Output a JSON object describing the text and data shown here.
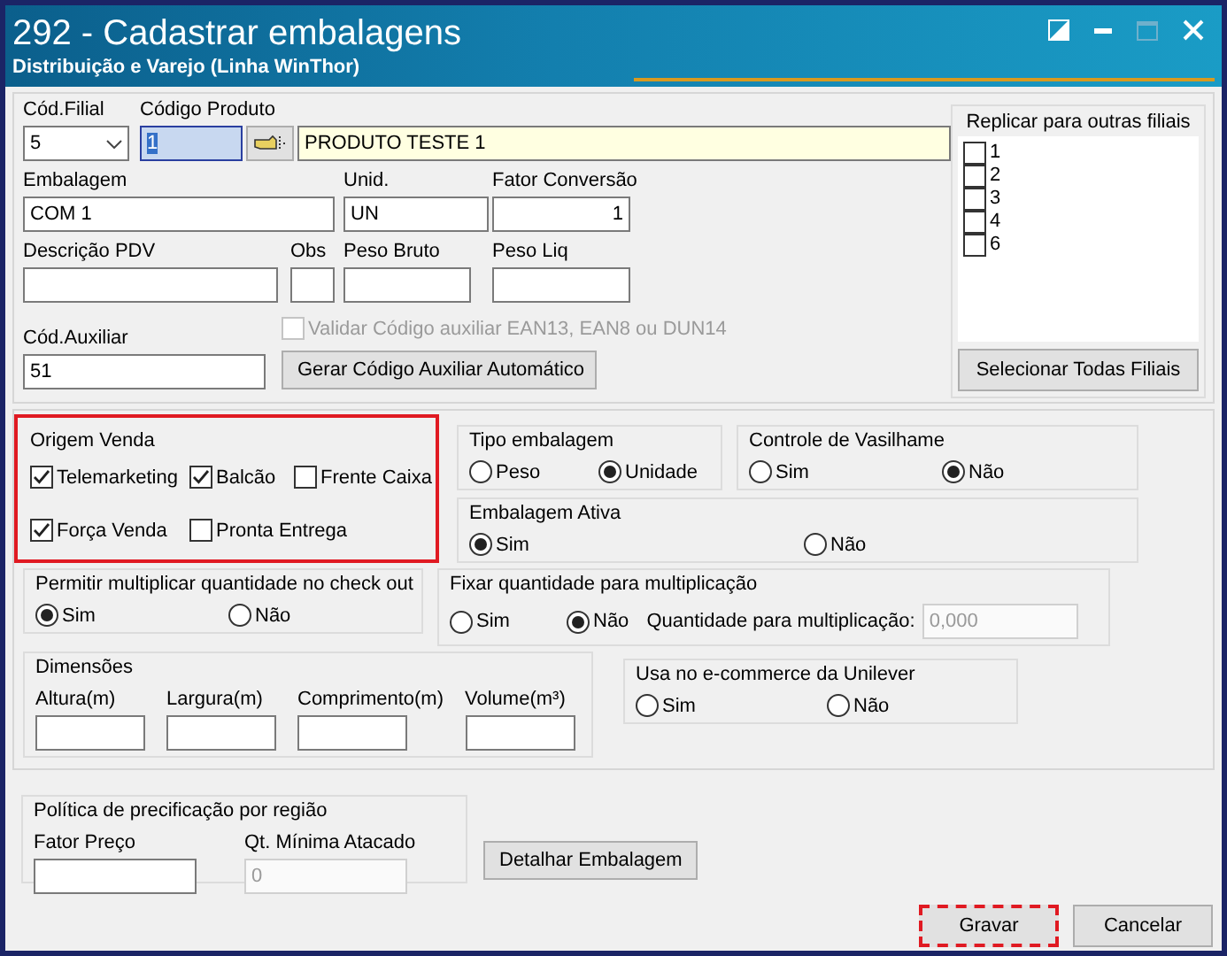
{
  "window": {
    "title": "292 - Cadastrar embalagens",
    "subtitle": "Distribuição e Varejo (Linha WinThor)"
  },
  "cod_filial": {
    "label": "Cód.Filial",
    "value": "5"
  },
  "codigo_produto": {
    "label": "Código Produto",
    "value": "1",
    "selected": true,
    "product_name": "PRODUTO TESTE 1"
  },
  "embalagem": {
    "label": "Embalagem",
    "value": "COM 1"
  },
  "unid": {
    "label": "Unid.",
    "value": "UN"
  },
  "fator_conversao": {
    "label": "Fator Conversão",
    "value": "1"
  },
  "descricao_pdv": {
    "label": "Descrição PDV"
  },
  "obs": {
    "label": "Obs"
  },
  "peso_bruto": {
    "label": "Peso Bruto"
  },
  "peso_liq": {
    "label": "Peso Liq"
  },
  "validar": {
    "label": "Validar Código auxiliar EAN13, EAN8 ou DUN14",
    "checked": false,
    "disabled": true
  },
  "cod_auxiliar": {
    "label": "Cód.Auxiliar",
    "value": "51"
  },
  "gerar_button": "Gerar Código Auxiliar Automático",
  "replicar": {
    "title": "Replicar para outras filiais",
    "items": [
      {
        "label": "1",
        "checked": false
      },
      {
        "label": "2",
        "checked": false
      },
      {
        "label": "3",
        "checked": false
      },
      {
        "label": "4",
        "checked": false
      },
      {
        "label": "6",
        "checked": false
      }
    ],
    "button": "Selecionar Todas Filiais"
  },
  "origem_venda": {
    "title": "Origem Venda",
    "highlighted": true,
    "options": [
      {
        "label": "Telemarketing",
        "checked": true
      },
      {
        "label": "Balcão",
        "checked": true
      },
      {
        "label": "Frente Caixa",
        "checked": false
      },
      {
        "label": "Força Venda",
        "checked": true
      },
      {
        "label": "Pronta Entrega",
        "checked": false
      }
    ]
  },
  "tipo_embalagem": {
    "title": "Tipo embalagem",
    "options": [
      {
        "label": "Peso",
        "selected": false
      },
      {
        "label": "Unidade",
        "selected": true
      }
    ]
  },
  "controle_vasilhame": {
    "title": "Controle de Vasilhame",
    "options": [
      {
        "label": "Sim",
        "selected": false
      },
      {
        "label": "Não",
        "selected": true
      }
    ]
  },
  "embalagem_ativa": {
    "title": "Embalagem Ativa",
    "options": [
      {
        "label": "Sim",
        "selected": true
      },
      {
        "label": "Não",
        "selected": false
      }
    ]
  },
  "permitir_multiplicar": {
    "title": "Permitir multiplicar quantidade no check out",
    "options": [
      {
        "label": "Sim",
        "selected": true
      },
      {
        "label": "Não",
        "selected": false
      }
    ]
  },
  "fixar_quantidade": {
    "title": "Fixar quantidade para multiplicação",
    "options": [
      {
        "label": "Sim",
        "selected": false
      },
      {
        "label": "Não",
        "selected": true
      }
    ],
    "quantity": {
      "label": "Quantidade para multiplicação:",
      "value": "0,000",
      "disabled": true
    }
  },
  "dimensoes": {
    "title": "Dimensões",
    "fields": [
      {
        "label": "Altura(m)"
      },
      {
        "label": "Largura(m)"
      },
      {
        "label": "Comprimento(m)"
      },
      {
        "label": "Volume(m³)"
      }
    ]
  },
  "ecommerce": {
    "title": "Usa no e-commerce da Unilever",
    "options": [
      {
        "label": "Sim",
        "selected": false
      },
      {
        "label": "Não",
        "selected": false
      }
    ]
  },
  "politica": {
    "title": "Política de precificação por região",
    "fields": [
      {
        "label": "Fator Preço",
        "disabled": false
      },
      {
        "label": "Qt. Mínima Atacado",
        "value": "0",
        "disabled": true
      }
    ]
  },
  "detalhar_button": "Detalhar Embalagem",
  "buttons": [
    {
      "label": "Gravar",
      "highlighted": true
    },
    {
      "label": "Cancelar",
      "highlighted": false
    }
  ]
}
